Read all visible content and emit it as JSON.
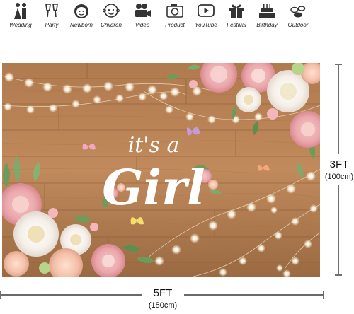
{
  "categories": [
    {
      "label": "Wedding",
      "icon": "bride-groom-icon"
    },
    {
      "label": "Party",
      "icon": "cheers-glasses-icon"
    },
    {
      "label": "Newborn",
      "icon": "baby-face-icon"
    },
    {
      "label": "Children",
      "icon": "child-face-icon"
    },
    {
      "label": "Video",
      "icon": "video-camera-icon"
    },
    {
      "label": "Product",
      "icon": "photo-camera-icon"
    },
    {
      "label": "YouTube",
      "icon": "play-button-icon"
    },
    {
      "label": "Festival",
      "icon": "gift-box-icon"
    },
    {
      "label": "Birthday",
      "icon": "birthday-cake-icon"
    },
    {
      "label": "Outdoor",
      "icon": "stones-icon"
    }
  ],
  "backdrop": {
    "line1": "it's a",
    "line2": "Girl"
  },
  "dimensions": {
    "height_ft": "3FT",
    "height_cm": "(100cm)",
    "width_ft": "5FT",
    "width_cm": "(150cm)"
  }
}
